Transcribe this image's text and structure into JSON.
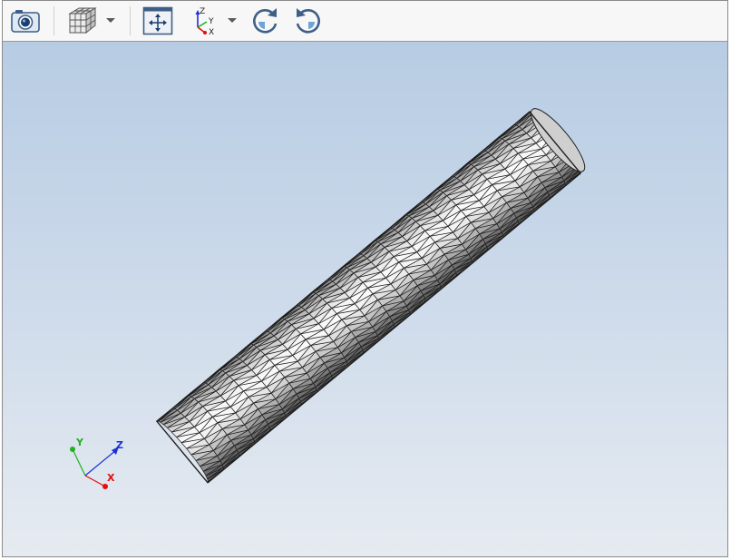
{
  "toolbar": {
    "buttons": [
      {
        "name": "screenshot-button",
        "icon": "camera-icon"
      },
      {
        "name": "display-style-button",
        "icon": "cube-icon",
        "has_dropdown": true
      },
      {
        "name": "fit-view-button",
        "icon": "fit-to-window-icon"
      },
      {
        "name": "view-orientation-button",
        "icon": "axes-orientation-icon",
        "has_dropdown": true
      },
      {
        "name": "rotate-clockwise-button",
        "icon": "rotate-cw-icon"
      },
      {
        "name": "rotate-counterclockwise-button",
        "icon": "rotate-ccw-icon"
      }
    ],
    "axes_icon_labels": {
      "z": "Z",
      "y": "Y",
      "x": "X"
    }
  },
  "viewport": {
    "background_top": "#b7cce3",
    "background_bottom": "#e6ebf1",
    "model": "meshed-cylinder",
    "triad": {
      "x_label": "X",
      "y_label": "Y",
      "z_label": "Z",
      "x_color": "#e01010",
      "y_color": "#20b020",
      "z_color": "#1a2fd8"
    }
  }
}
